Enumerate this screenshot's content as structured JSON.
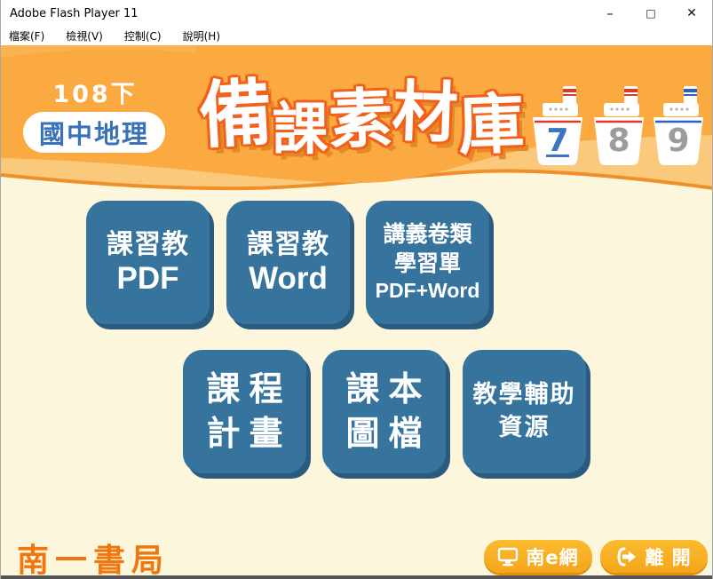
{
  "window": {
    "title": "Adobe Flash Player 11",
    "controls": {
      "minimize": "–",
      "maximize": "□",
      "close": "✕"
    }
  },
  "menu": {
    "items": [
      "檔案(F)",
      "檢視(V)",
      "控制(C)",
      "說明(H)"
    ]
  },
  "header": {
    "semester": "108下",
    "subject": "國中地理",
    "title": "備課素材庫",
    "ships": [
      {
        "number": "7",
        "accent": "#d93a2b",
        "active": true
      },
      {
        "number": "8",
        "accent": "#d93a2b",
        "active": false
      },
      {
        "number": "9",
        "accent": "#2f62b8",
        "active": false
      }
    ]
  },
  "tiles": {
    "row1": [
      {
        "lines": [
          "課習教",
          "PDF"
        ]
      },
      {
        "lines": [
          "課習教",
          "Word"
        ]
      },
      {
        "lines": [
          "講義卷類",
          "學習單",
          "PDF+Word"
        ]
      }
    ],
    "row2": [
      {
        "lines": [
          "課程",
          "計畫"
        ]
      },
      {
        "lines": [
          "課本",
          "圖檔"
        ]
      },
      {
        "lines": [
          "教學輔助",
          "資源"
        ]
      }
    ]
  },
  "footer": {
    "logo": "南一書局",
    "buttons": [
      {
        "label": "南e網",
        "icon": "monitor-icon"
      },
      {
        "label": "離 開",
        "icon": "exit-icon"
      }
    ]
  },
  "colors": {
    "header_orange": "#faaa40",
    "wave_band": "#fbc97b",
    "wave_line": "#ef8f28",
    "body_cream": "#fcf7dc",
    "tile_blue": "#36749e",
    "tile_shadow": "#2a5a7d",
    "subject_blue": "#3a72b9",
    "title_outline": "#f2611b",
    "logo_orange": "#f0770f",
    "footer_button_orange": "#f5a51c",
    "ship_red": "#d93a2b",
    "ship_blue": "#2f62b8",
    "active_number_blue": "#3b76c0",
    "inactive_number_gray": "#9c9c9c"
  }
}
